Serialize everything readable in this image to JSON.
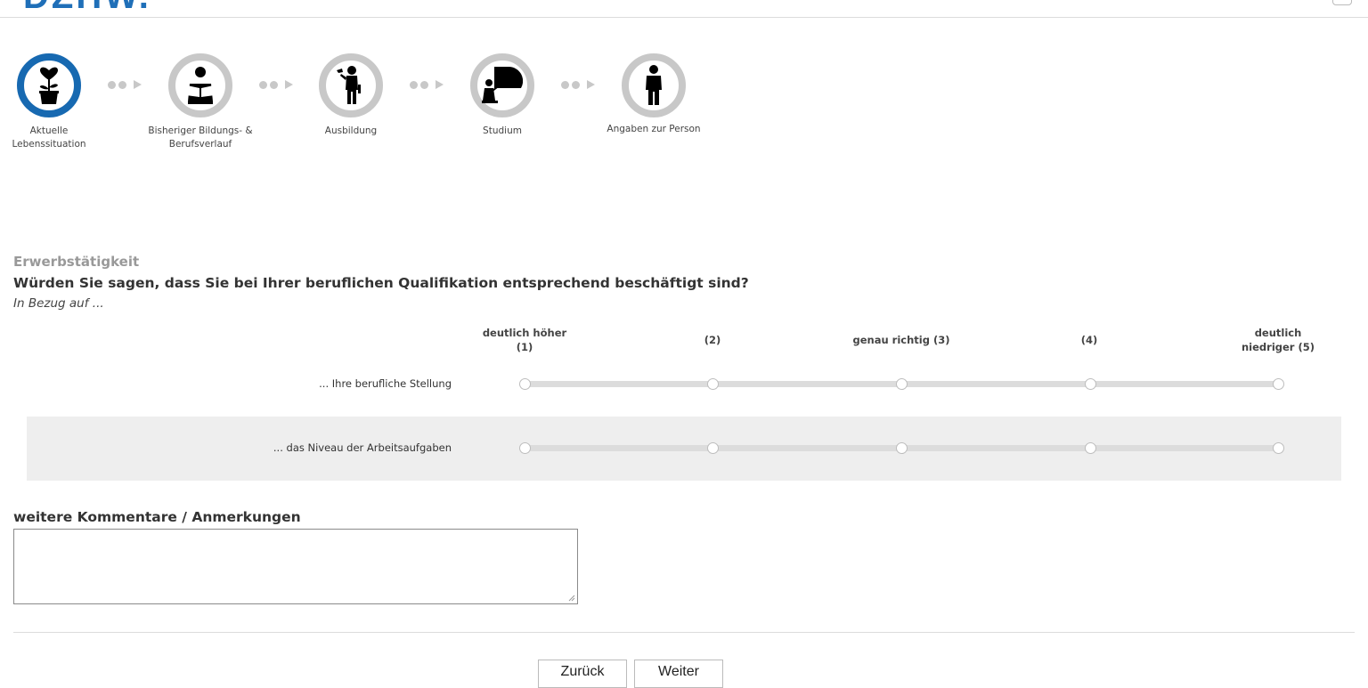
{
  "header": {
    "logo_text": "DZHW."
  },
  "steps": [
    {
      "label": "Aktuelle Lebenssituation",
      "icon": "flower-heart-icon",
      "active": true
    },
    {
      "label": "Bisheriger Bildungs- & Berufsverlauf",
      "icon": "person-reading-icon",
      "active": false
    },
    {
      "label": "Ausbildung",
      "icon": "worker-icon",
      "active": false
    },
    {
      "label": "Studium",
      "icon": "lecturer-icon",
      "active": false
    },
    {
      "label": "Angaben zur Person",
      "icon": "person-icon",
      "active": false
    }
  ],
  "question": {
    "section": "Erwerbstätigkeit",
    "text": "Würden Sie sagen, dass Sie bei Ihrer beruflichen Qualifikation entsprechend beschäftigt sind?",
    "hint": "In Bezug auf ..."
  },
  "scale": {
    "labels": [
      "deutlich höher (1)",
      "(2)",
      "genau richtig (3)",
      "(4)",
      "deutlich niedriger (5)"
    ]
  },
  "items": [
    {
      "label": "... Ihre berufliche Stellung",
      "selected": null
    },
    {
      "label": "... das Niveau der Arbeitsaufgaben",
      "selected": null
    }
  ],
  "comments": {
    "title": "weitere Kommentare / Anmerkungen",
    "value": ""
  },
  "nav": {
    "back_label": "Zurück",
    "next_label": "Weiter"
  },
  "colors": {
    "accent": "#1769b1",
    "inactive": "#c8c8c8",
    "band": "#eeeeee"
  }
}
